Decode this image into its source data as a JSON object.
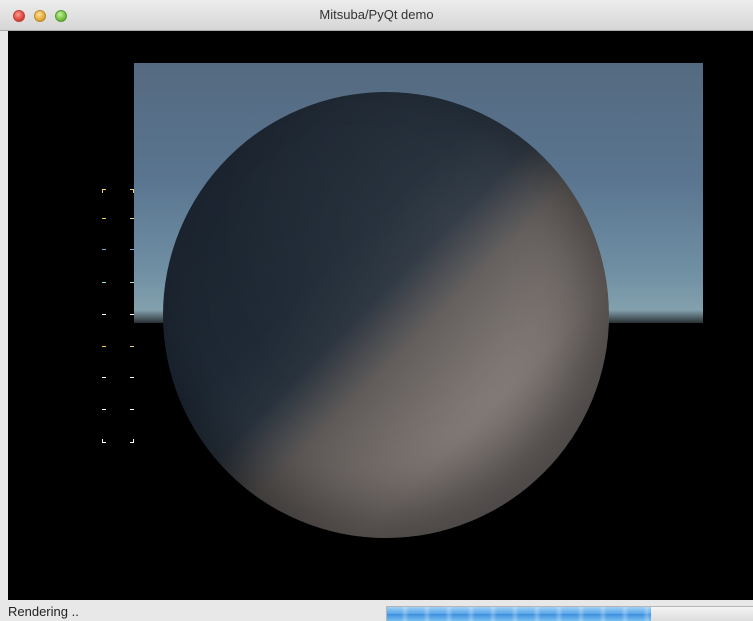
{
  "window": {
    "title": "Mitsuba/PyQt demo"
  },
  "statusbar": {
    "text": "Rendering ..",
    "progress_fraction": 0.72
  },
  "colors": {
    "accent": "#4a9be6",
    "canvas_background": "#000000",
    "sky": "#5a7590",
    "sphere_light": "#847c79",
    "sphere_dark": "#1e2935"
  },
  "icons": {
    "close": "close-icon",
    "minimize": "minimize-icon",
    "zoom": "zoom-icon"
  }
}
